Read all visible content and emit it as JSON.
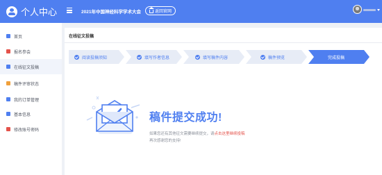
{
  "header": {
    "app_title": "个人中心",
    "conference_title": "2021年中国神经科学学术大会",
    "home_button": "返回官网",
    "user_avatar_icon": "user-avatar",
    "menu_icon": "hamburger-icon"
  },
  "sidebar": {
    "items": [
      {
        "label": "首页",
        "icon": "home-icon",
        "color": "#4f7ff0"
      },
      {
        "label": "报名参会",
        "icon": "register-icon",
        "color": "#e4534b"
      },
      {
        "label": "在线征文投稿",
        "icon": "submit-icon",
        "color": "#4f7ff0"
      },
      {
        "label": "稿件评审状态",
        "icon": "review-icon",
        "color": "#f0a03c"
      },
      {
        "label": "我的订单管理",
        "icon": "order-icon",
        "color": "#4f7ff0"
      },
      {
        "label": "基本信息",
        "icon": "info-icon",
        "color": "#4f7ff0"
      },
      {
        "label": "修改账号密码",
        "icon": "password-icon",
        "color": "#e4534b"
      }
    ]
  },
  "main": {
    "section_title": "在线征文投稿",
    "steps": [
      {
        "label": "阅读投稿须知",
        "done": true
      },
      {
        "label": "填写作者信息",
        "done": true
      },
      {
        "label": "填写稿件内容",
        "done": true
      },
      {
        "label": "稿件预览",
        "done": true
      },
      {
        "label": "完成投稿",
        "current": true
      }
    ],
    "success": {
      "title": "稿件提交成功!",
      "line1_prefix": "如果您还有其他征文需要继续提交，请",
      "line1_link": "点击这里继续投稿",
      "line1_suffix": "",
      "line2": "再次感谢您的支持!"
    }
  },
  "colors": {
    "brand": "#4f7ff0",
    "step_bg": "#e7ecf6",
    "alert": "#e4534b"
  }
}
